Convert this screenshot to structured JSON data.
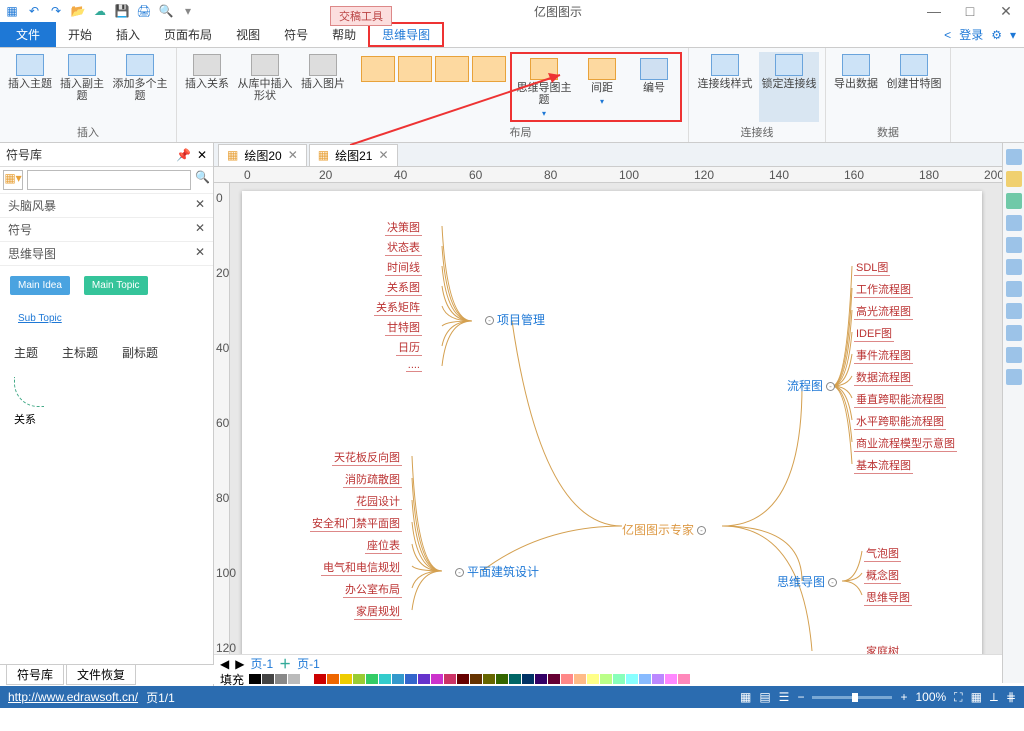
{
  "app_title": "亿图图示",
  "context_tool": "交稿工具",
  "qat_tips": [
    "menu",
    "undo",
    "redo",
    "open",
    "cloud",
    "save",
    "print",
    "preview",
    "more"
  ],
  "win": [
    "—",
    "□",
    "✕"
  ],
  "tabs": {
    "file": "文件",
    "items": [
      "开始",
      "插入",
      "页面布局",
      "视图",
      "符号",
      "帮助"
    ],
    "active": "思维导图",
    "right_login": "登录"
  },
  "ribbon": {
    "g1": {
      "items": [
        "插入主题",
        "插入副主题",
        "添加多个主题"
      ],
      "title": "插入"
    },
    "g2": {
      "items": [
        "插入关系",
        "从库中插入形状",
        "插入图片"
      ]
    },
    "g_layout_small": [
      "l1",
      "l2",
      "l3",
      "l4"
    ],
    "g_layout": {
      "items": [
        "思维导图主题",
        "间距",
        "编号"
      ],
      "title": "布局"
    },
    "g_conn": {
      "items": [
        "连接线样式",
        "锁定连接线"
      ],
      "title": "连接线"
    },
    "g_data": {
      "items": [
        "导出数据",
        "创建甘特图"
      ],
      "title": "数据"
    }
  },
  "left": {
    "title": "符号库",
    "pin": "📌",
    "close": "✕",
    "cats": [
      "头脑风暴",
      "符号",
      "思维导图"
    ],
    "shapes": [
      {
        "label": "Main Idea",
        "bg": "#4aa3e0"
      },
      {
        "label": "Main Topic",
        "bg": "#35c49a"
      },
      {
        "label": "Sub Topic",
        "bg": "transparent",
        "color": "#1e78d6",
        "underline": true
      }
    ],
    "shape_labels": [
      "主题",
      "主标题",
      "副标题"
    ],
    "rel": "关系",
    "bottom_tabs": [
      "符号库",
      "文件恢复"
    ]
  },
  "docs": [
    {
      "name": "绘图20"
    },
    {
      "name": "绘图21",
      "active": true
    }
  ],
  "ruler_marks": [
    0,
    20,
    40,
    60,
    80,
    100,
    120,
    140,
    160,
    180,
    200
  ],
  "ruler_v": [
    0,
    20,
    40,
    60,
    80,
    100,
    120
  ],
  "mindmap": {
    "center": "亿图图示专家",
    "b1": {
      "name": "项目管理",
      "leaves": [
        "决策图",
        "状态表",
        "时间线",
        "关系图",
        "关系矩阵",
        "甘特图",
        "日历",
        "...."
      ]
    },
    "b2": {
      "name": "平面建筑设计",
      "leaves": [
        "天花板反向图",
        "消防疏散图",
        "花园设计",
        "安全和门禁平面图",
        "座位表",
        "电气和电信规划",
        "办公室布局",
        "家居规划"
      ]
    },
    "b3": {
      "name": "流程图",
      "leaves": [
        "SDL图",
        "工作流程图",
        "高光流程图",
        "IDEF图",
        "事件流程图",
        "数据流程图",
        "垂直跨职能流程图",
        "水平跨职能流程图",
        "商业流程模型示意图",
        "基本流程图"
      ]
    },
    "b4": {
      "name": "思维导图",
      "leaves": [
        "气泡图",
        "概念图",
        "思维导图"
      ]
    },
    "b5": {
      "name": "",
      "leaves": [
        "家庭树"
      ]
    }
  },
  "page_nav": {
    "left": "页-1",
    "right": "页-1",
    "fill": "填充"
  },
  "colors": [
    "#000",
    "#444",
    "#888",
    "#bbb",
    "#fff",
    "#c00",
    "#e60",
    "#ec0",
    "#9c3",
    "#3c6",
    "#3cc",
    "#39c",
    "#36c",
    "#63c",
    "#c3c",
    "#c36",
    "#600",
    "#630",
    "#660",
    "#360",
    "#066",
    "#036",
    "#306",
    "#603",
    "#f88",
    "#fb8",
    "#ff8",
    "#bf8",
    "#8fb",
    "#8ff",
    "#8bf",
    "#b8f",
    "#f8f",
    "#f8b"
  ],
  "status": {
    "url": "http://www.edrawsoft.cn/",
    "page": "页1/1",
    "zoom": "100%"
  }
}
